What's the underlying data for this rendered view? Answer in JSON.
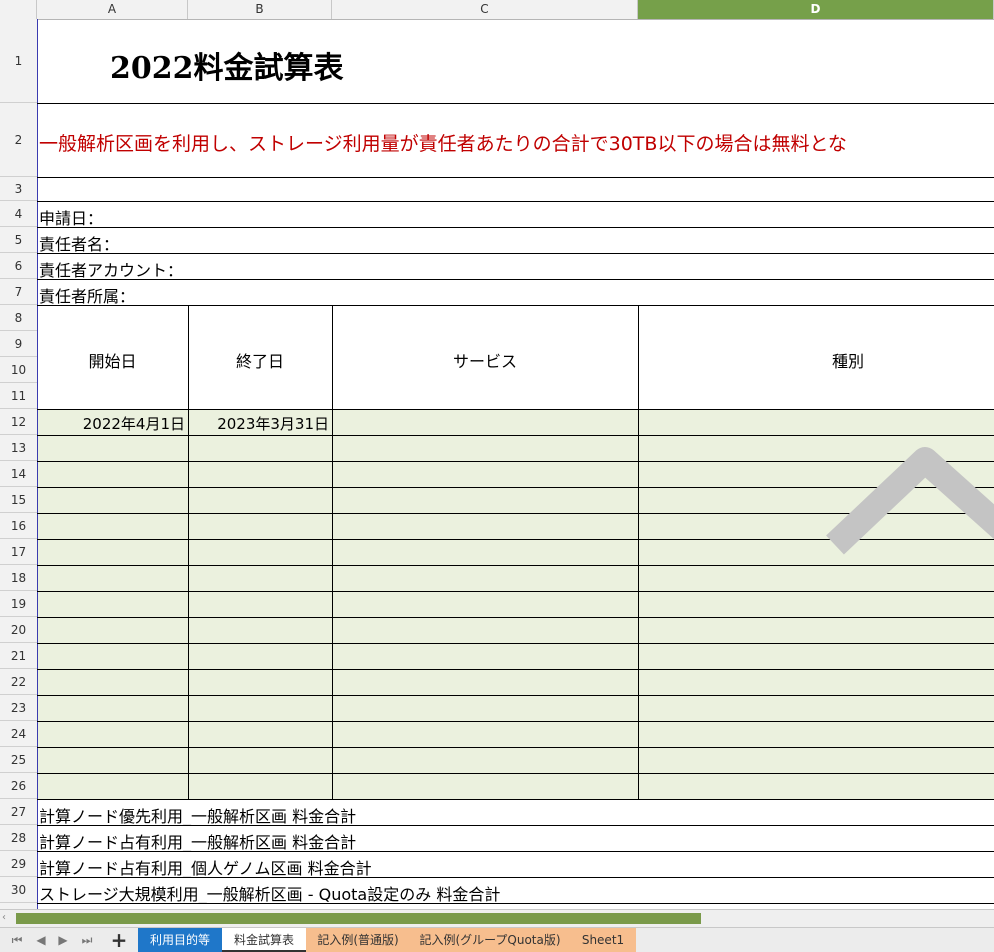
{
  "columns": [
    "A",
    "B",
    "C",
    "D"
  ],
  "rows": [
    "1",
    "2",
    "3",
    "4",
    "5",
    "6",
    "7",
    "8",
    "9",
    "10",
    "11",
    "12",
    "13",
    "14",
    "15",
    "16",
    "17",
    "18",
    "19",
    "20",
    "21",
    "22",
    "23",
    "24",
    "25",
    "26",
    "27",
    "28",
    "29",
    "30"
  ],
  "sheet": {
    "title": "2022料金試算表",
    "notice": "一般解析区画を利用し、ストレージ利用量が責任者あたりの合計で30TB以下の場合は無料とな",
    "fields": {
      "application_date": "申請日：",
      "owner_name": "責任者名：",
      "owner_account": "責任者アカウント：",
      "owner_affiliation": "責任者所属："
    },
    "table_headers": {
      "start_date": "開始日",
      "end_date": "終了日",
      "service": "サービス",
      "type": "種別"
    },
    "first_row": {
      "start_date": "2022年4月1日",
      "end_date": "2023年3月31日"
    },
    "totals": [
      "計算ノード優先利用_一般解析区画 料金合計",
      "計算ノード占有利用_一般解析区画 料金合計",
      "計算ノード占有利用_個人ゲノム区画 料金合計",
      "ストレージ大規模利用_一般解析区画 - Quota設定のみ 料金合計"
    ]
  },
  "tabs": [
    {
      "label": "利用目的等",
      "color": "#1f77c9",
      "text_color": "#ffffff"
    },
    {
      "label": "料金試算表",
      "color": "#ffffff",
      "text_color": "#333333"
    },
    {
      "label": "記入例(普通版)",
      "color": "#f7be8e",
      "text_color": "#333333"
    },
    {
      "label": "記入例(グループQuota版)",
      "color": "#f7be8e",
      "text_color": "#333333"
    },
    {
      "label": "Sheet1",
      "color": "#f7be8e",
      "text_color": "#333333"
    }
  ],
  "colors": {
    "accent": "#76a04a",
    "notice": "#c00000",
    "input_fill": "#ebf1de"
  }
}
